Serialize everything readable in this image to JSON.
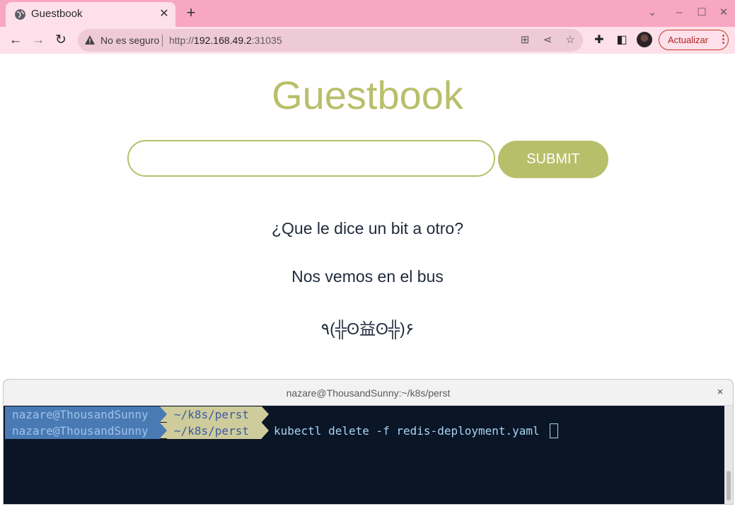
{
  "browser": {
    "tab_title": "Guestbook",
    "tab_close": "✕",
    "new_tab": "+",
    "address_security": "No es seguro",
    "url_prefix": "http://",
    "url_host": "192.168.49.2",
    "url_port": ":31035",
    "update_label": "Actualizar",
    "update_menu": "⋮",
    "accent": "#f8a7c3"
  },
  "page": {
    "title": "Guestbook",
    "input_value": "",
    "submit_label": "SUBMIT",
    "entries": [
      "¿Que le dice un bit a otro?",
      "Nos vemos en el bus",
      "٩(╬ʘ益ʘ╬)۶"
    ],
    "brand_color": "#b8bf6a"
  },
  "terminal": {
    "title": "nazare@ThousandSunny:~/k8s/perst",
    "close": "×",
    "lines": [
      {
        "user": "nazare@ThousandSunny",
        "dir": "~/k8s/perst",
        "command": ""
      },
      {
        "user": "nazare@ThousandSunny",
        "dir": "~/k8s/perst",
        "command": "kubectl delete -f redis-deployment.yaml"
      }
    ]
  }
}
